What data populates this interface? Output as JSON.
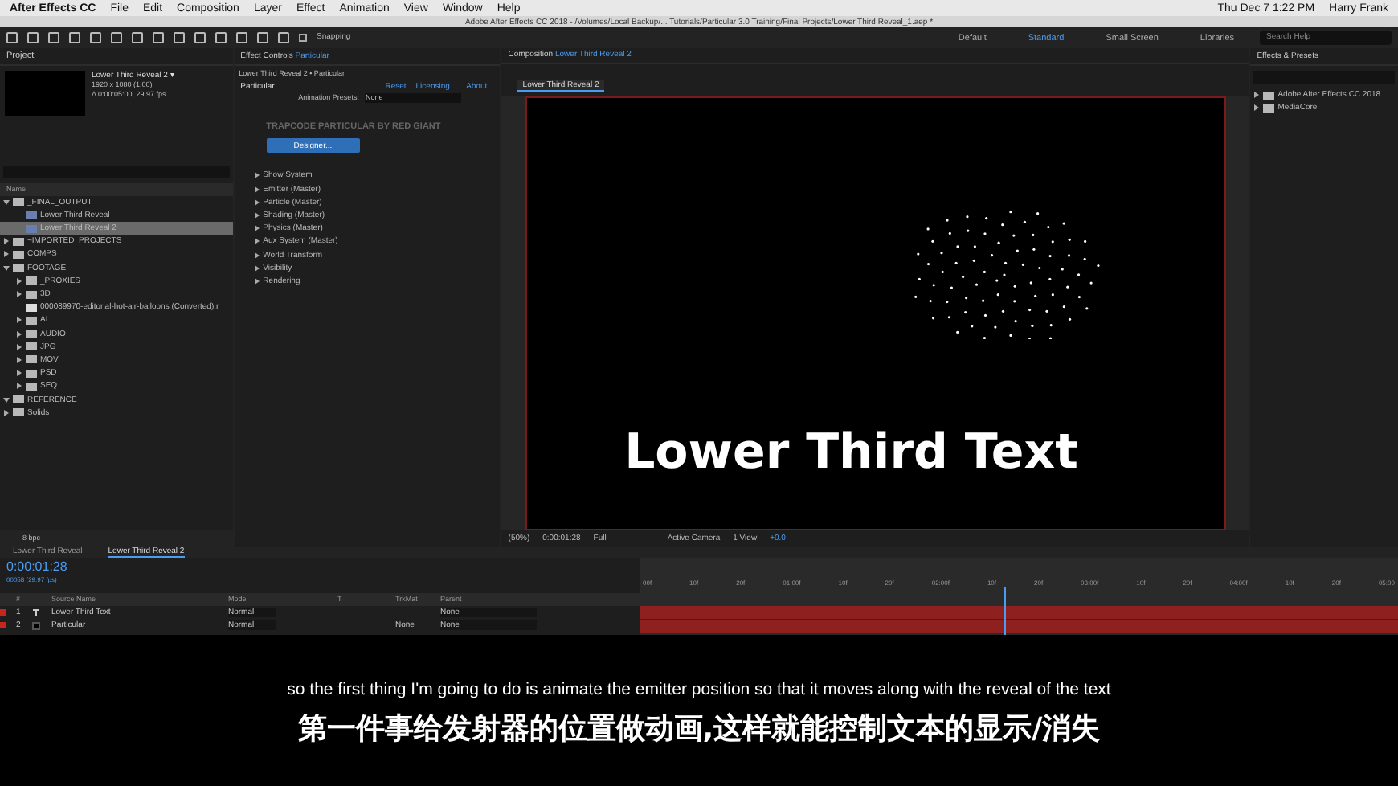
{
  "menu_bar": {
    "app": "After Effects CC",
    "items": [
      "File",
      "Edit",
      "Composition",
      "Layer",
      "Effect",
      "Animation",
      "View",
      "Window",
      "Help"
    ],
    "clock": "Thu Dec 7  1:22 PM",
    "user": "Harry Frank"
  },
  "window_title": "Adobe After Effects CC 2018 - /Volumes/Local Backup/... Tutorials/Particular 3.0 Training/Final Projects/Lower Third Reveal_1.aep *",
  "toolbar": {
    "snapping": {
      "label": "Snapping",
      "checked": false
    },
    "workspaces": [
      {
        "label": "Default",
        "selected": false
      },
      {
        "label": "Standard",
        "selected": true
      },
      {
        "label": "Small Screen",
        "selected": false
      },
      {
        "label": "Libraries",
        "selected": false
      }
    ],
    "search_placeholder": "Search Help"
  },
  "project": {
    "title": "Project",
    "comp_name": "Lower Third Reveal 2 ▾",
    "comp_info": [
      "1920 x 1080 (1.00)",
      "Δ 0:00:05:00, 29.97 fps"
    ],
    "name_column": "Name",
    "bpc": "8 bpc",
    "tree": [
      {
        "label": "_FINAL_OUTPUT",
        "kind": "folder",
        "expanded": true,
        "selected": false,
        "children": [
          {
            "label": "Lower Third Reveal",
            "kind": "comp",
            "selected": false
          },
          {
            "label": "Lower Third Reveal 2",
            "kind": "comp",
            "selected": true
          }
        ]
      },
      {
        "label": "~IMPORTED_PROJECTS",
        "kind": "folder",
        "expanded": false,
        "selected": false
      },
      {
        "label": "COMPS",
        "kind": "folder",
        "expanded": false,
        "selected": false
      },
      {
        "label": "FOOTAGE",
        "kind": "folder",
        "expanded": true,
        "selected": false,
        "children": [
          {
            "label": "_PROXIES",
            "kind": "folder",
            "expanded": false,
            "selected": false
          },
          {
            "label": "3D",
            "kind": "folder",
            "expanded": false,
            "selected": false
          },
          {
            "label": "000089970-editorial-hot-air-balloons (Converted).r",
            "kind": "file",
            "selected": false
          },
          {
            "label": "AI",
            "kind": "folder",
            "expanded": false,
            "selected": false
          },
          {
            "label": "AUDIO",
            "kind": "folder",
            "expanded": false,
            "selected": false
          },
          {
            "label": "JPG",
            "kind": "folder",
            "expanded": false,
            "selected": false
          },
          {
            "label": "MOV",
            "kind": "folder",
            "expanded": false,
            "selected": false
          },
          {
            "label": "PSD",
            "kind": "folder",
            "expanded": false,
            "selected": false
          },
          {
            "label": "SEQ",
            "kind": "folder",
            "expanded": false,
            "selected": false
          }
        ]
      },
      {
        "label": "REFERENCE",
        "kind": "folder",
        "expanded": true,
        "selected": false
      },
      {
        "label": "Solids",
        "kind": "folder",
        "expanded": false,
        "selected": false
      }
    ]
  },
  "effect_controls": {
    "title": "Effect Controls",
    "layer": "Particular",
    "subtitle": "Lower Third Reveal 2 • Particular",
    "effect": "Particular",
    "links": [
      "Reset",
      "Licensing...",
      "About..."
    ],
    "presets_label": "Animation Presets:",
    "presets_value": "None",
    "brand": "TRAPCODE PARTICULAR BY RED GIANT",
    "designer_button": "Designer...",
    "groups": [
      "Show System",
      "Emitter (Master)",
      "Particle (Master)",
      "Shading (Master)",
      "Physics (Master)",
      "Aux System (Master)",
      "World Transform",
      "Visibility",
      "Rendering"
    ]
  },
  "composition": {
    "title": "Composition",
    "comp_name": "Lower Third Reveal 2",
    "tab": "Lower Third Reveal 2",
    "overlay_text": "Lower Third Text",
    "viewer_toolbar": {
      "zoom": "(50%)",
      "time": "0:00:01:28",
      "resolution": "Full",
      "camera": "Active Camera",
      "views": "1 View",
      "exposure": "+0.0"
    }
  },
  "effects_presets": {
    "title": "Effects & Presets",
    "items": [
      "Adobe After Effects CC 2018",
      "MediaCore"
    ]
  },
  "timeline": {
    "tabs": [
      {
        "label": "Lower Third Reveal",
        "selected": false
      },
      {
        "label": "Lower Third Reveal 2",
        "selected": true
      }
    ],
    "time": "0:00:01:28",
    "frames": "00058 (29.97 fps)",
    "columns": [
      "#",
      "Source Name",
      "Mode",
      "T",
      "TrkMat",
      "Parent"
    ],
    "ruler": [
      "00f",
      "10f",
      "20f",
      "01:00f",
      "10f",
      "20f",
      "02:00f",
      "10f",
      "20f",
      "03:00f",
      "10f",
      "20f",
      "04:00f",
      "10f",
      "20f",
      "05:00"
    ],
    "playhead": {
      "level": 0.48
    },
    "layers": [
      {
        "number": "1",
        "kind": "text",
        "name": "Lower Third Text",
        "mode": "Normal",
        "parent": "None"
      },
      {
        "number": "2",
        "kind": "solid",
        "name": "Particular",
        "mode": "Normal",
        "trkmat": "None",
        "parent": "None"
      }
    ]
  },
  "subtitles": {
    "english": "so the first thing I'm going to do is animate the emitter position so that it moves along with the reveal of the text",
    "chinese": "第一件事给发射器的位置做动画,这样就能控制文本的显示/消失"
  }
}
